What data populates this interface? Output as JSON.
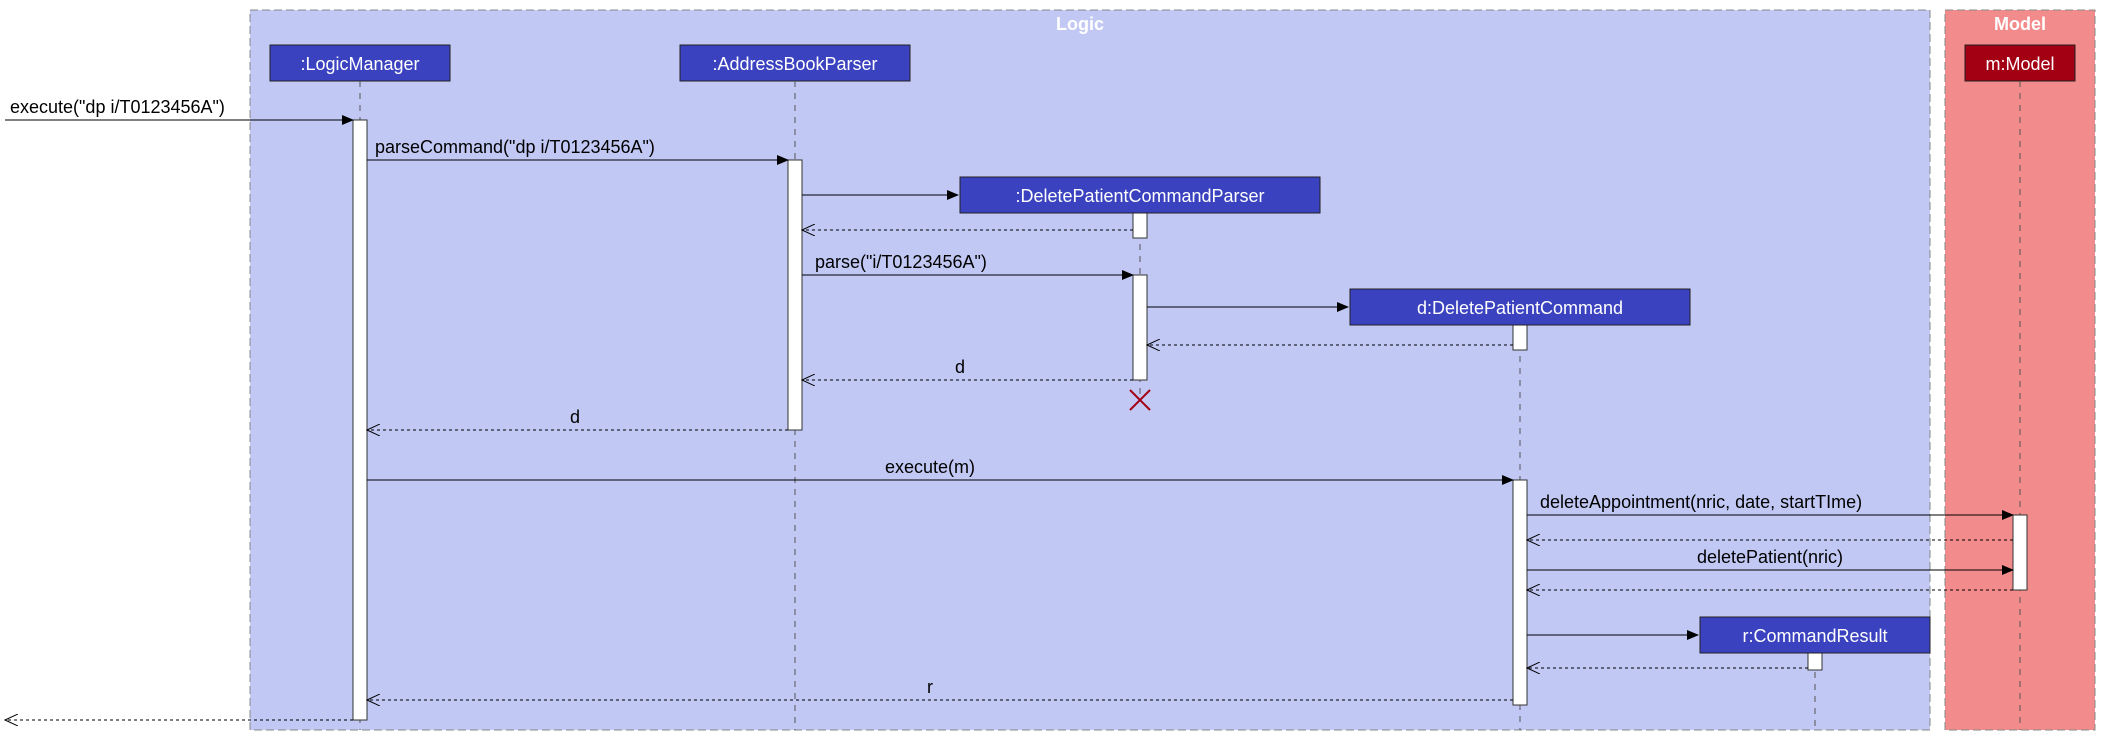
{
  "boxes": {
    "logic_title": "Logic",
    "model_title": "Model"
  },
  "participants": {
    "logicManager": ":LogicManager",
    "abParser": ":AddressBookParser",
    "dpcParser": ":DeletePatientCommandParser",
    "dpc": "d:DeletePatientCommand",
    "cmdResult": "r:CommandResult",
    "model": "m:Model"
  },
  "messages": {
    "m1": "execute(\"dp i/T0123456A\")",
    "m2": "parseCommand(\"dp i/T0123456A\")",
    "m3_blank": "",
    "m4": "parse(\"i/T0123456A\")",
    "m5_blank": "",
    "m6": "d",
    "m7": "d",
    "m8": "execute(m)",
    "m9": "deleteAppointment(nric, date, startTIme)",
    "m10_blank": "",
    "m11": "deletePatient(nric)",
    "m12_blank": "",
    "m13_blank": "",
    "m14_blank": "",
    "m15": "r",
    "m16_blank": ""
  },
  "chart_data": {
    "type": "sequence_diagram",
    "boxes": [
      {
        "name": "Logic",
        "participants": [
          "LogicManager",
          "AddressBookParser",
          "DeletePatientCommandParser",
          "DeletePatientCommand",
          "CommandResult"
        ]
      },
      {
        "name": "Model",
        "participants": [
          "Model"
        ]
      }
    ],
    "participants": [
      {
        "id": "actor",
        "label": "",
        "external": true
      },
      {
        "id": "LogicManager",
        "label": ":LogicManager"
      },
      {
        "id": "AddressBookParser",
        "label": ":AddressBookParser"
      },
      {
        "id": "DeletePatientCommandParser",
        "label": ":DeletePatientCommandParser",
        "created_by_msg": 3
      },
      {
        "id": "DeletePatientCommand",
        "label": "d:DeletePatientCommand",
        "created_by_msg": 5
      },
      {
        "id": "CommandResult",
        "label": "r:CommandResult",
        "created_by_msg": 13
      },
      {
        "id": "Model",
        "label": "m:Model"
      }
    ],
    "messages": [
      {
        "n": 1,
        "from": "actor",
        "to": "LogicManager",
        "label": "execute(\"dp i/T0123456A\")",
        "type": "sync"
      },
      {
        "n": 2,
        "from": "LogicManager",
        "to": "AddressBookParser",
        "label": "parseCommand(\"dp i/T0123456A\")",
        "type": "sync"
      },
      {
        "n": 3,
        "from": "AddressBookParser",
        "to": "DeletePatientCommandParser",
        "label": "",
        "type": "create"
      },
      {
        "n": 3.5,
        "from": "DeletePatientCommandParser",
        "to": "AddressBookParser",
        "label": "",
        "type": "return"
      },
      {
        "n": 4,
        "from": "AddressBookParser",
        "to": "DeletePatientCommandParser",
        "label": "parse(\"i/T0123456A\")",
        "type": "sync"
      },
      {
        "n": 5,
        "from": "DeletePatientCommandParser",
        "to": "DeletePatientCommand",
        "label": "",
        "type": "create"
      },
      {
        "n": 5.5,
        "from": "DeletePatientCommand",
        "to": "DeletePatientCommandParser",
        "label": "",
        "type": "return"
      },
      {
        "n": 6,
        "from": "DeletePatientCommandParser",
        "to": "AddressBookParser",
        "label": "d",
        "type": "return"
      },
      {
        "n": 6.5,
        "from": "DeletePatientCommandParser",
        "to": "DeletePatientCommandParser",
        "label": "",
        "type": "destroy"
      },
      {
        "n": 7,
        "from": "AddressBookParser",
        "to": "LogicManager",
        "label": "d",
        "type": "return"
      },
      {
        "n": 8,
        "from": "LogicManager",
        "to": "DeletePatientCommand",
        "label": "execute(m)",
        "type": "sync"
      },
      {
        "n": 9,
        "from": "DeletePatientCommand",
        "to": "Model",
        "label": "deleteAppointment(nric, date, startTIme)",
        "type": "sync"
      },
      {
        "n": 10,
        "from": "Model",
        "to": "DeletePatientCommand",
        "label": "",
        "type": "return"
      },
      {
        "n": 11,
        "from": "DeletePatientCommand",
        "to": "Model",
        "label": "deletePatient(nric)",
        "type": "sync"
      },
      {
        "n": 12,
        "from": "Model",
        "to": "DeletePatientCommand",
        "label": "",
        "type": "return"
      },
      {
        "n": 13,
        "from": "DeletePatientCommand",
        "to": "CommandResult",
        "label": "",
        "type": "create"
      },
      {
        "n": 14,
        "from": "CommandResult",
        "to": "DeletePatientCommand",
        "label": "",
        "type": "return"
      },
      {
        "n": 15,
        "from": "DeletePatientCommand",
        "to": "LogicManager",
        "label": "r",
        "type": "return"
      },
      {
        "n": 16,
        "from": "LogicManager",
        "to": "actor",
        "label": "",
        "type": "return"
      }
    ]
  }
}
